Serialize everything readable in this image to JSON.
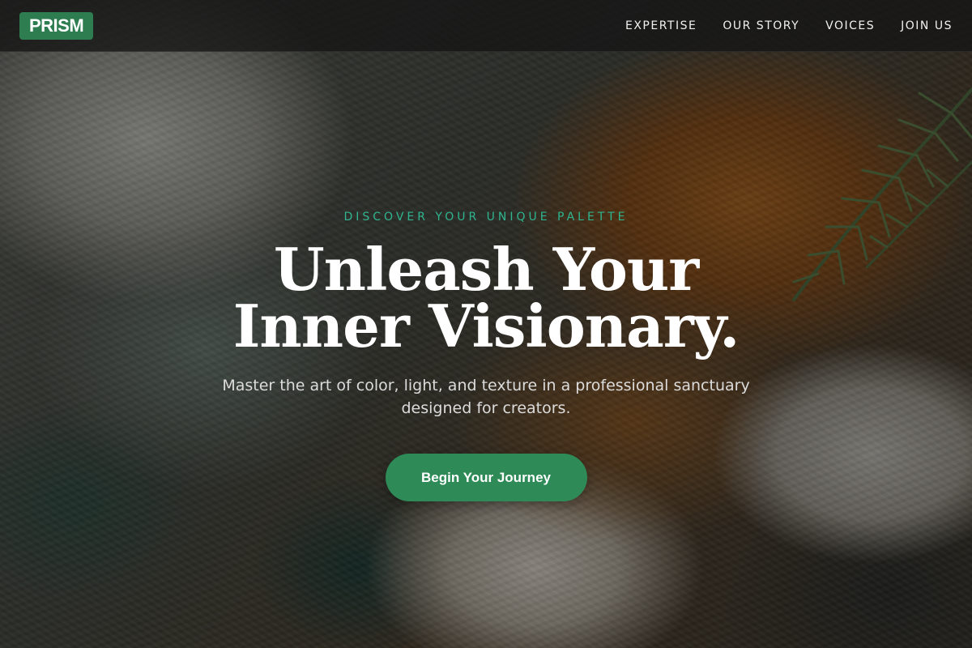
{
  "nav": {
    "logo": "PRISM",
    "links": [
      "EXPERTISE",
      "OUR STORY",
      "VOICES",
      "JOIN US"
    ]
  },
  "hero": {
    "eyebrow": "DISCOVER YOUR UNIQUE PALETTE",
    "headline": "Unleash Your Inner Visionary.",
    "subtitle": "Master the art of color, light, and texture in a professional sanctuary designed for creators.",
    "cta_label": "Begin Your Journey"
  },
  "colors": {
    "brand_green": "#2e7d51",
    "accent_teal": "#2fb58f",
    "cta_green": "#2e8a56"
  }
}
